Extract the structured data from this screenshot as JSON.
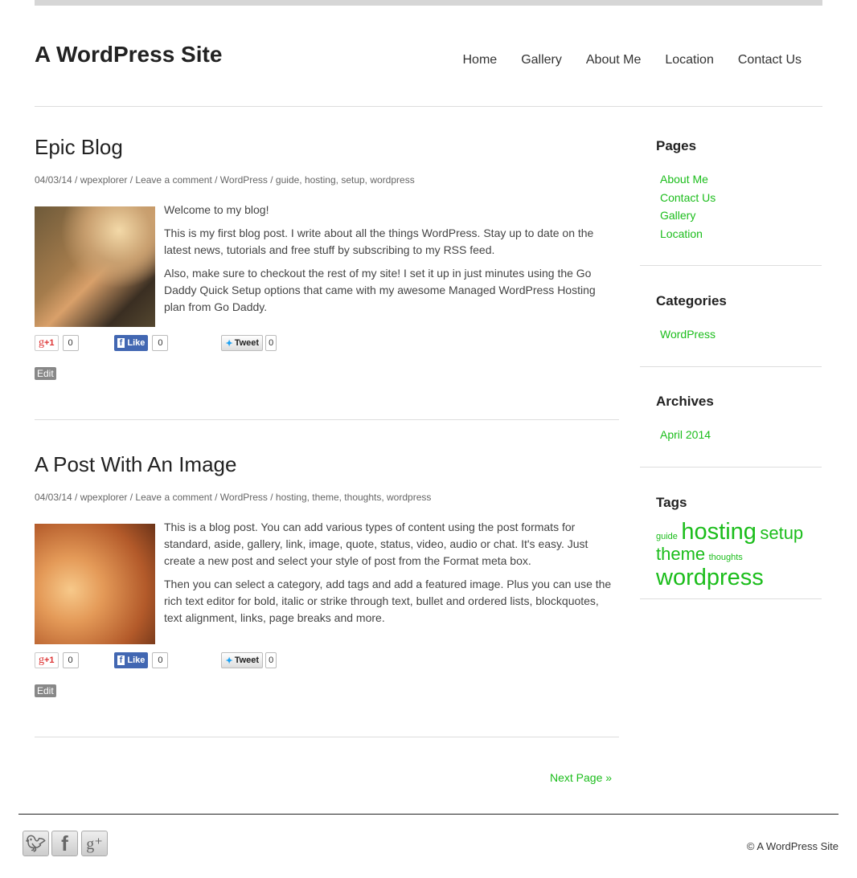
{
  "site": {
    "title": "A WordPress Site"
  },
  "nav": [
    "Home",
    "Gallery",
    "About Me",
    "Location",
    "Contact Us"
  ],
  "posts": [
    {
      "title": "Epic Blog",
      "meta": "04/03/14 / wpexplorer / Leave a comment / WordPress / guide, hosting, setup, wordpress",
      "paragraphs": [
        "Welcome to my blog!",
        "This is my first blog post. I write about all the things WordPress. Stay up to date on the latest news, tutorials and free stuff by subscribing to my RSS feed.",
        "Also, make sure to checkout the rest of my site! I set it up in just minutes using the Go Daddy Quick Setup options that came with my awesome Managed WordPress Hosting plan from Go Daddy."
      ],
      "share": {
        "gplus": "+1",
        "gplus_count": "0",
        "like": "Like",
        "like_count": "0",
        "tweet": "Tweet",
        "tweet_count": "0"
      },
      "edit": "Edit"
    },
    {
      "title": "A Post With An Image",
      "meta": "04/03/14 / wpexplorer / Leave a comment / WordPress / hosting, theme, thoughts, wordpress",
      "paragraphs": [
        "This is a blog post. You can add various types of content using the post formats for standard, aside, gallery, link, image, quote, status, video, audio or chat. It's easy. Just create a new post and select your style of post from the Format meta box.",
        "Then you can select a category, add tags and add a featured image. Plus you can use the rich text editor for bold, italic or strike through text, bullet and ordered lists, blockquotes, text alignment, links, page breaks and more."
      ],
      "share": {
        "gplus": "+1",
        "gplus_count": "0",
        "like": "Like",
        "like_count": "0",
        "tweet": "Tweet",
        "tweet_count": "0"
      },
      "edit": "Edit"
    }
  ],
  "pagination": {
    "next": "Next Page »"
  },
  "sidebar": {
    "pages": {
      "title": "Pages",
      "items": [
        "About Me",
        "Contact Us",
        "Gallery",
        "Location"
      ]
    },
    "categories": {
      "title": "Categories",
      "items": [
        "WordPress"
      ]
    },
    "archives": {
      "title": "Archives",
      "items": [
        "April 2014"
      ]
    },
    "tags": {
      "title": "Tags",
      "items": [
        "guide",
        "hosting",
        "setup",
        "theme",
        "thoughts",
        "wordpress"
      ]
    }
  },
  "footer": {
    "copyright": "© A WordPress Site",
    "social": [
      "twitter-icon",
      "facebook-icon",
      "google-plus-icon"
    ]
  },
  "colors": {
    "link": "#1bbd1b",
    "facebook": "#4267b2"
  }
}
